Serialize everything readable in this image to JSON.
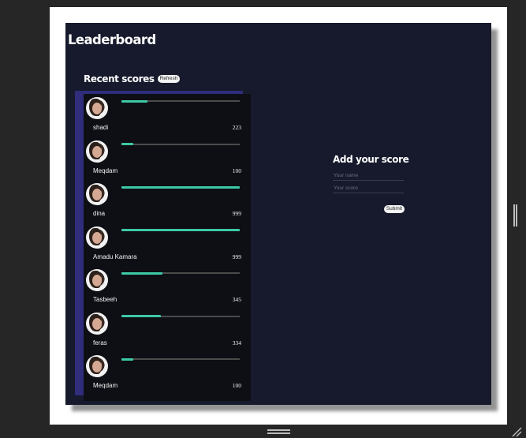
{
  "app": {
    "title": "Leaderboard"
  },
  "recent": {
    "title": "Recent scores",
    "refresh_label": "Refresh",
    "max_score": 999,
    "entries": [
      {
        "name": "shadi",
        "score": "223",
        "fraction": 0.223
      },
      {
        "name": "Meqdam",
        "score": "100",
        "fraction": 0.1
      },
      {
        "name": "dina",
        "score": "999",
        "fraction": 0.999
      },
      {
        "name": "Amadu Kamara",
        "score": "999",
        "fraction": 0.999
      },
      {
        "name": "Tasbeeh",
        "score": "345",
        "fraction": 0.345
      },
      {
        "name": "feras",
        "score": "334",
        "fraction": 0.334
      },
      {
        "name": "Meqdam",
        "score": "100",
        "fraction": 0.1
      }
    ]
  },
  "form": {
    "title": "Add your score",
    "name_placeholder": "Your name",
    "score_placeholder": "Your score",
    "name_value": "",
    "score_value": "",
    "submit_label": "Submit"
  },
  "colors": {
    "background": "#161a2c",
    "list_background": "#0e0f15",
    "list_border": "#2f2d7c",
    "progress_fill": "#3cc9a6",
    "progress_track": "#4b4b4b"
  }
}
